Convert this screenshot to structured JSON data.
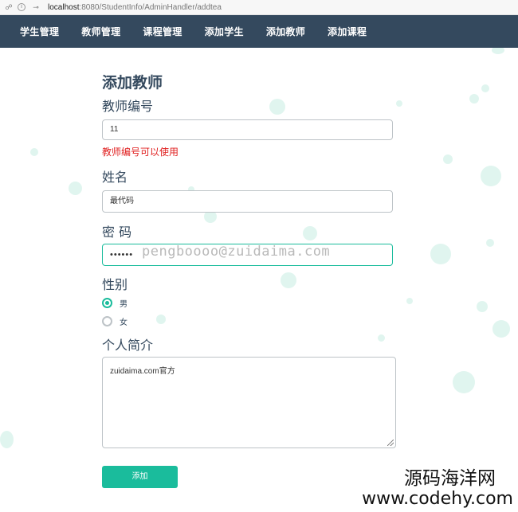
{
  "browser": {
    "url_host": "localhost",
    "url_path": ":8080/StudentInfo/AdminHandler/addtea"
  },
  "nav": {
    "items": [
      {
        "label": "学生管理"
      },
      {
        "label": "教师管理"
      },
      {
        "label": "课程管理"
      },
      {
        "label": "添加学生"
      },
      {
        "label": "添加教师"
      },
      {
        "label": "添加课程"
      }
    ]
  },
  "form": {
    "title": "添加教师",
    "teacher_id_label": "教师编号",
    "teacher_id_value": "11",
    "teacher_id_hint": "教师编号可以使用",
    "name_label": "姓名",
    "name_value": "最代码",
    "password_label": "密 码",
    "password_masked": "••••••",
    "password_overlay": "pengboooo@zuidaima.com",
    "gender_label": "性别",
    "gender_options": [
      {
        "label": "男",
        "checked": true
      },
      {
        "label": "女",
        "checked": false
      }
    ],
    "bio_label": "个人简介",
    "bio_value": "zuidaima.com官方",
    "submit_label": "添加"
  },
  "brand": {
    "cn": "源码海洋网",
    "en": "www.codehy.com"
  },
  "colors": {
    "navbar": "#34495e",
    "accent": "#1abc9c",
    "error": "#e02020"
  }
}
